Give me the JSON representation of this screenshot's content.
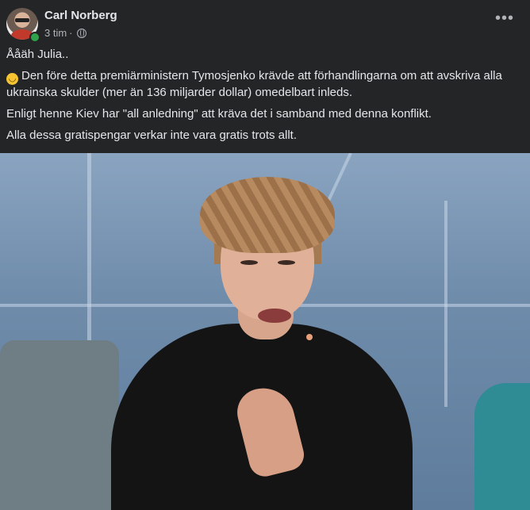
{
  "post": {
    "author": "Carl Norberg",
    "time": "3 tim",
    "separator": "·",
    "privacy_icon": "globe-icon",
    "more_icon": "more-options-icon",
    "online": true
  },
  "content": {
    "line1": "Ååäh Julia..",
    "line2_emoji": "🙃",
    "line2": "Den före detta premiärministern Tymosjenko krävde att förhandlingarna om att avskriva alla ukrainska skulder (mer än 136 miljarder dollar) omedelbart inleds.",
    "line3": "Enligt henne Kiev har  \"all anledning\" att kräva det i samband med denna konflikt.",
    "line4": "Alla dessa gratispengar verkar inte vara gratis trots allt."
  },
  "colors": {
    "background": "#242526",
    "text": "#e4e6eb",
    "secondary_text": "#b0b3b8",
    "online": "#31a24c"
  }
}
